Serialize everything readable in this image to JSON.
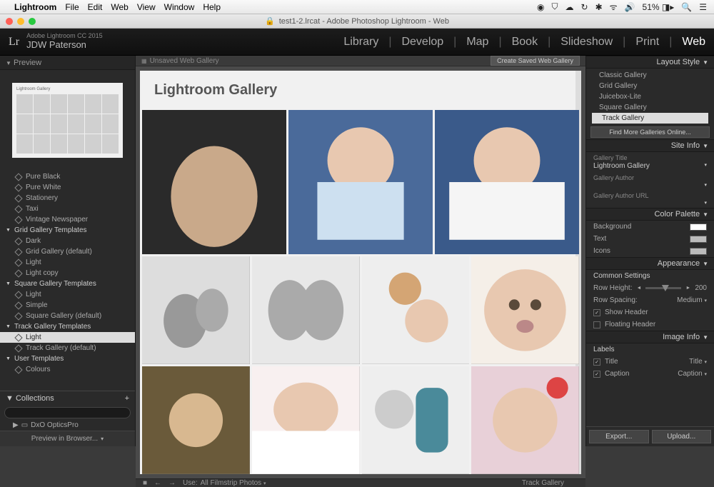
{
  "mac_menu": {
    "apple": "",
    "app": "Lightroom",
    "items": [
      "File",
      "Edit",
      "Web",
      "View",
      "Window",
      "Help"
    ],
    "right": {
      "battery": "51%",
      "time": "",
      "icons": [
        "◎",
        "⛨",
        "☁",
        "⟳",
        "✽",
        "ᯤ",
        "🔊"
      ]
    }
  },
  "titlebar": {
    "icon": "🔒",
    "title": "test1-2.lrcat - Adobe Photoshop Lightroom - Web"
  },
  "header": {
    "logo": "Lr",
    "brand_line": "Adobe Lightroom CC 2015",
    "owner": "JDW Paterson",
    "modules": [
      "Library",
      "Develop",
      "Map",
      "Book",
      "Slideshow",
      "Print",
      "Web"
    ],
    "active": "Web"
  },
  "left": {
    "preview_hdr": "Preview",
    "preview_title": "Lightroom Gallery",
    "tree": [
      {
        "t": "Pure Black",
        "h": false
      },
      {
        "t": "Pure White",
        "h": false
      },
      {
        "t": "Stationery",
        "h": false
      },
      {
        "t": "Taxi",
        "h": false
      },
      {
        "t": "Vintage Newspaper",
        "h": false
      },
      {
        "t": "Grid Gallery Templates",
        "h": true
      },
      {
        "t": "Dark",
        "h": false
      },
      {
        "t": "Grid Gallery (default)",
        "h": false
      },
      {
        "t": "Light",
        "h": false
      },
      {
        "t": "Light copy",
        "h": false
      },
      {
        "t": "Square Gallery Templates",
        "h": true
      },
      {
        "t": "Light",
        "h": false
      },
      {
        "t": "Simple",
        "h": false
      },
      {
        "t": "Square Gallery (default)",
        "h": false
      },
      {
        "t": "Track Gallery Templates",
        "h": true
      },
      {
        "t": "Light",
        "h": false,
        "sel": true
      },
      {
        "t": "Track Gallery (default)",
        "h": false
      },
      {
        "t": "User Templates",
        "h": true
      },
      {
        "t": "Colours",
        "h": false
      }
    ],
    "collections": {
      "hdr": "Collections",
      "plus": "+",
      "item": "DxO OpticsPro"
    },
    "preview_browser": "Preview in Browser..."
  },
  "center": {
    "top_label": "Unsaved Web Gallery",
    "saved_btn": "Create Saved Web Gallery",
    "gallery_title": "Lightroom Gallery",
    "bottom": {
      "use_label": "Use:",
      "use_value": "All Filmstrip Photos",
      "track": "Track Gallery"
    }
  },
  "right": {
    "layout_style": {
      "hdr": "Layout Style",
      "items": [
        "Classic Gallery",
        "Grid Gallery",
        "Juicebox-Lite",
        "Square Gallery",
        "Track Gallery"
      ],
      "selected": "Track Gallery",
      "find": "Find More Galleries Online..."
    },
    "site_info": {
      "hdr": "Site Info",
      "title_lbl": "Gallery Title",
      "title_val": "Lightroom Gallery",
      "author_lbl": "Gallery Author",
      "author_url_lbl": "Gallery Author URL"
    },
    "color_palette": {
      "hdr": "Color Palette",
      "bg": "Background",
      "text": "Text",
      "icons": "Icons"
    },
    "appearance": {
      "hdr": "Appearance",
      "common": "Common Settings",
      "row_height_lbl": "Row Height:",
      "row_height_val": "200",
      "row_spacing_lbl": "Row Spacing:",
      "row_spacing_val": "Medium",
      "show_header": "Show Header",
      "floating_header": "Floating Header"
    },
    "image_info": {
      "hdr": "Image Info",
      "labels": "Labels",
      "title_chk": "Title",
      "title_val": "Title",
      "caption_chk": "Caption",
      "caption_val": "Caption"
    },
    "buttons": {
      "export": "Export...",
      "upload": "Upload..."
    }
  }
}
